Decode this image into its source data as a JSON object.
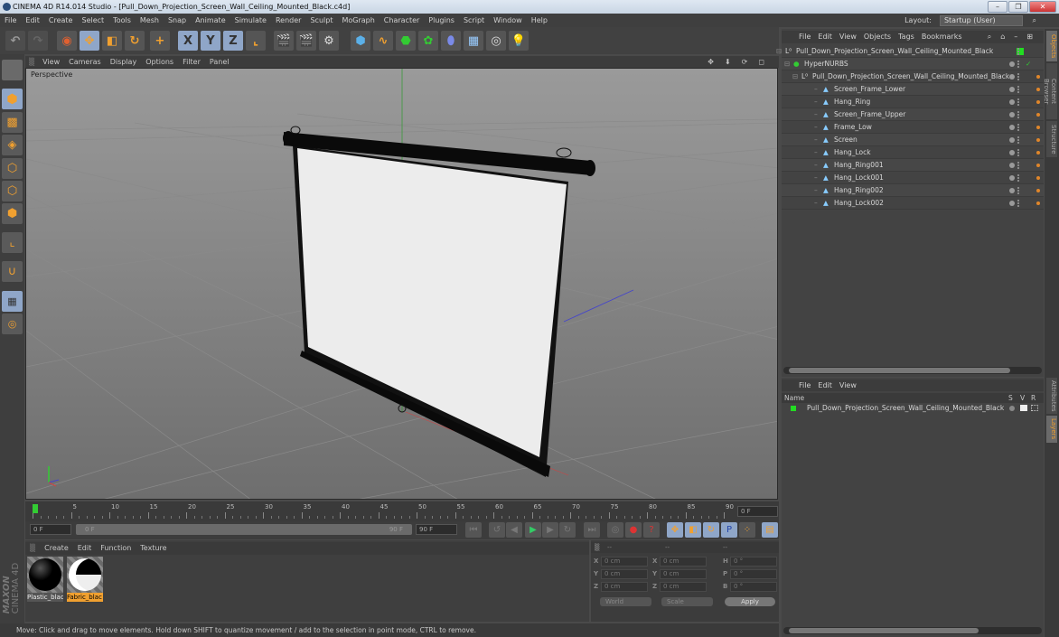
{
  "window": {
    "title": "CINEMA 4D R14.014 Studio - [Pull_Down_Projection_Screen_Wall_Ceiling_Mounted_Black.c4d]",
    "controls": [
      "minimize",
      "maximize",
      "close"
    ]
  },
  "menubar": {
    "items": [
      "File",
      "Edit",
      "Create",
      "Select",
      "Tools",
      "Mesh",
      "Snap",
      "Animate",
      "Simulate",
      "Render",
      "Sculpt",
      "MoGraph",
      "Character",
      "Plugins",
      "Script",
      "Window",
      "Help"
    ],
    "layout_label": "Layout:",
    "layout_value": "Startup (User)"
  },
  "toolbar": {
    "icons": [
      "undo-icon",
      "redo-icon",
      "live-selection-icon",
      "move-icon",
      "scale-icon",
      "rotate-icon",
      "add-object-icon",
      "x-axis-icon",
      "y-axis-icon",
      "z-axis-icon",
      "coordinate-system-icon",
      "render-view-icon",
      "render-picture-viewer-icon",
      "render-settings-icon",
      "cube-icon",
      "spline-pen-icon",
      "nurbs-icon",
      "array-icon",
      "deformer-icon",
      "floor-icon",
      "camera-icon",
      "light-icon"
    ],
    "axis_labels": [
      "X",
      "Y",
      "Z"
    ]
  },
  "left_tools": [
    "make-editable-icon",
    "model-mode-icon",
    "texture-mode-icon",
    "workplane-icon",
    "points-mode-icon",
    "edges-mode-icon",
    "polygons-mode-icon",
    "axis-mode-icon",
    "magnet-icon",
    "locked-workplane-icon",
    "snap-icon"
  ],
  "viewport": {
    "menu": [
      "View",
      "Cameras",
      "Display",
      "Options",
      "Filter",
      "Panel"
    ],
    "camera_label": "Perspective",
    "nav_icons": [
      "move-view-icon",
      "zoom-view-icon",
      "rotate-view-icon",
      "maximize-view-icon"
    ]
  },
  "timeline": {
    "ticks": [
      "0",
      "5",
      "10",
      "15",
      "20",
      "25",
      "30",
      "35",
      "40",
      "45",
      "50",
      "55",
      "60",
      "65",
      "70",
      "75",
      "80",
      "85",
      "90"
    ],
    "current_frame": "0 F",
    "start_field": "0 F",
    "range_start": "0 F",
    "range_end": "90 F",
    "end_field": "90 F",
    "playback_icons": [
      "go-to-start-icon",
      "previous-key-icon",
      "previous-frame-icon",
      "play-icon",
      "next-frame-icon",
      "next-key-icon",
      "go-to-end-icon"
    ],
    "record_icons": [
      "motion-record-icon",
      "record-active-icon",
      "autokey-icon",
      "key-position-icon",
      "key-scale-icon",
      "key-rotation-icon",
      "key-param-icon",
      "key-pla-icon",
      "timeline-icon"
    ]
  },
  "materials": {
    "menu": [
      "Create",
      "Edit",
      "Function",
      "Texture"
    ],
    "items": [
      {
        "label": "Plastic_blac",
        "selected": false
      },
      {
        "label": "Fabric_blac",
        "selected": true
      }
    ],
    "brand_top": "MAXON",
    "brand_bottom": "CINEMA 4D"
  },
  "coordinates": {
    "headers": [
      "--",
      "--",
      "--"
    ],
    "rows": [
      {
        "a_label": "X",
        "a_val": "0 cm",
        "b_label": "X",
        "b_val": "0 cm",
        "c_label": "H",
        "c_val": "0 °"
      },
      {
        "a_label": "Y",
        "a_val": "0 cm",
        "b_label": "Y",
        "b_val": "0 cm",
        "c_label": "P",
        "c_val": "0 °"
      },
      {
        "a_label": "Z",
        "a_val": "0 cm",
        "b_label": "Z",
        "b_val": "0 cm",
        "c_label": "B",
        "c_val": "0 °"
      }
    ],
    "mode": "World",
    "transform": "Scale",
    "apply_label": "Apply"
  },
  "status": "Move: Click and drag to move elements. Hold down SHIFT to quantize movement / add to the selection in point mode, CTRL to remove.",
  "objects": {
    "menu": [
      "File",
      "Edit",
      "View",
      "Objects",
      "Tags",
      "Bookmarks"
    ],
    "rows": [
      {
        "name": "Pull_Down_Projection_Screen_Wall_Ceiling_Mounted_Black",
        "type": "null",
        "level": 0
      },
      {
        "name": "HyperNURBS",
        "type": "nurbs",
        "level": 1
      },
      {
        "name": "Pull_Down_Projection_Screen_Wall_Ceiling_Mounted_Black",
        "type": "null",
        "level": 2
      },
      {
        "name": "Screen_Frame_Lower",
        "type": "polygon",
        "level": 3
      },
      {
        "name": "Hang_Ring",
        "type": "polygon",
        "level": 3
      },
      {
        "name": "Screen_Frame_Upper",
        "type": "polygon",
        "level": 3
      },
      {
        "name": "Frame_Low",
        "type": "polygon",
        "level": 3
      },
      {
        "name": "Screen",
        "type": "polygon",
        "level": 3
      },
      {
        "name": "Hang_Lock",
        "type": "polygon",
        "level": 3
      },
      {
        "name": "Hang_Ring001",
        "type": "polygon",
        "level": 3
      },
      {
        "name": "Hang_Lock001",
        "type": "polygon",
        "level": 3
      },
      {
        "name": "Hang_Ring002",
        "type": "polygon",
        "level": 3
      },
      {
        "name": "Hang_Lock002",
        "type": "polygon",
        "level": 3
      }
    ]
  },
  "side_tabs_top": [
    "Objects",
    "Content Browser",
    "Structure"
  ],
  "side_tabs_bottom": [
    "Attributes",
    "Layers"
  ],
  "layers": {
    "menu": [
      "File",
      "Edit",
      "View"
    ],
    "columns": [
      "Name",
      "S",
      "V",
      "R"
    ],
    "rows": [
      {
        "name": "Pull_Down_Projection_Screen_Wall_Ceiling_Mounted_Black",
        "color": "#22dd22"
      }
    ]
  },
  "colors": {
    "accent_orange": "#f0a030",
    "selected_blue": "#8fa6c8",
    "layer_green": "#22dd22"
  }
}
